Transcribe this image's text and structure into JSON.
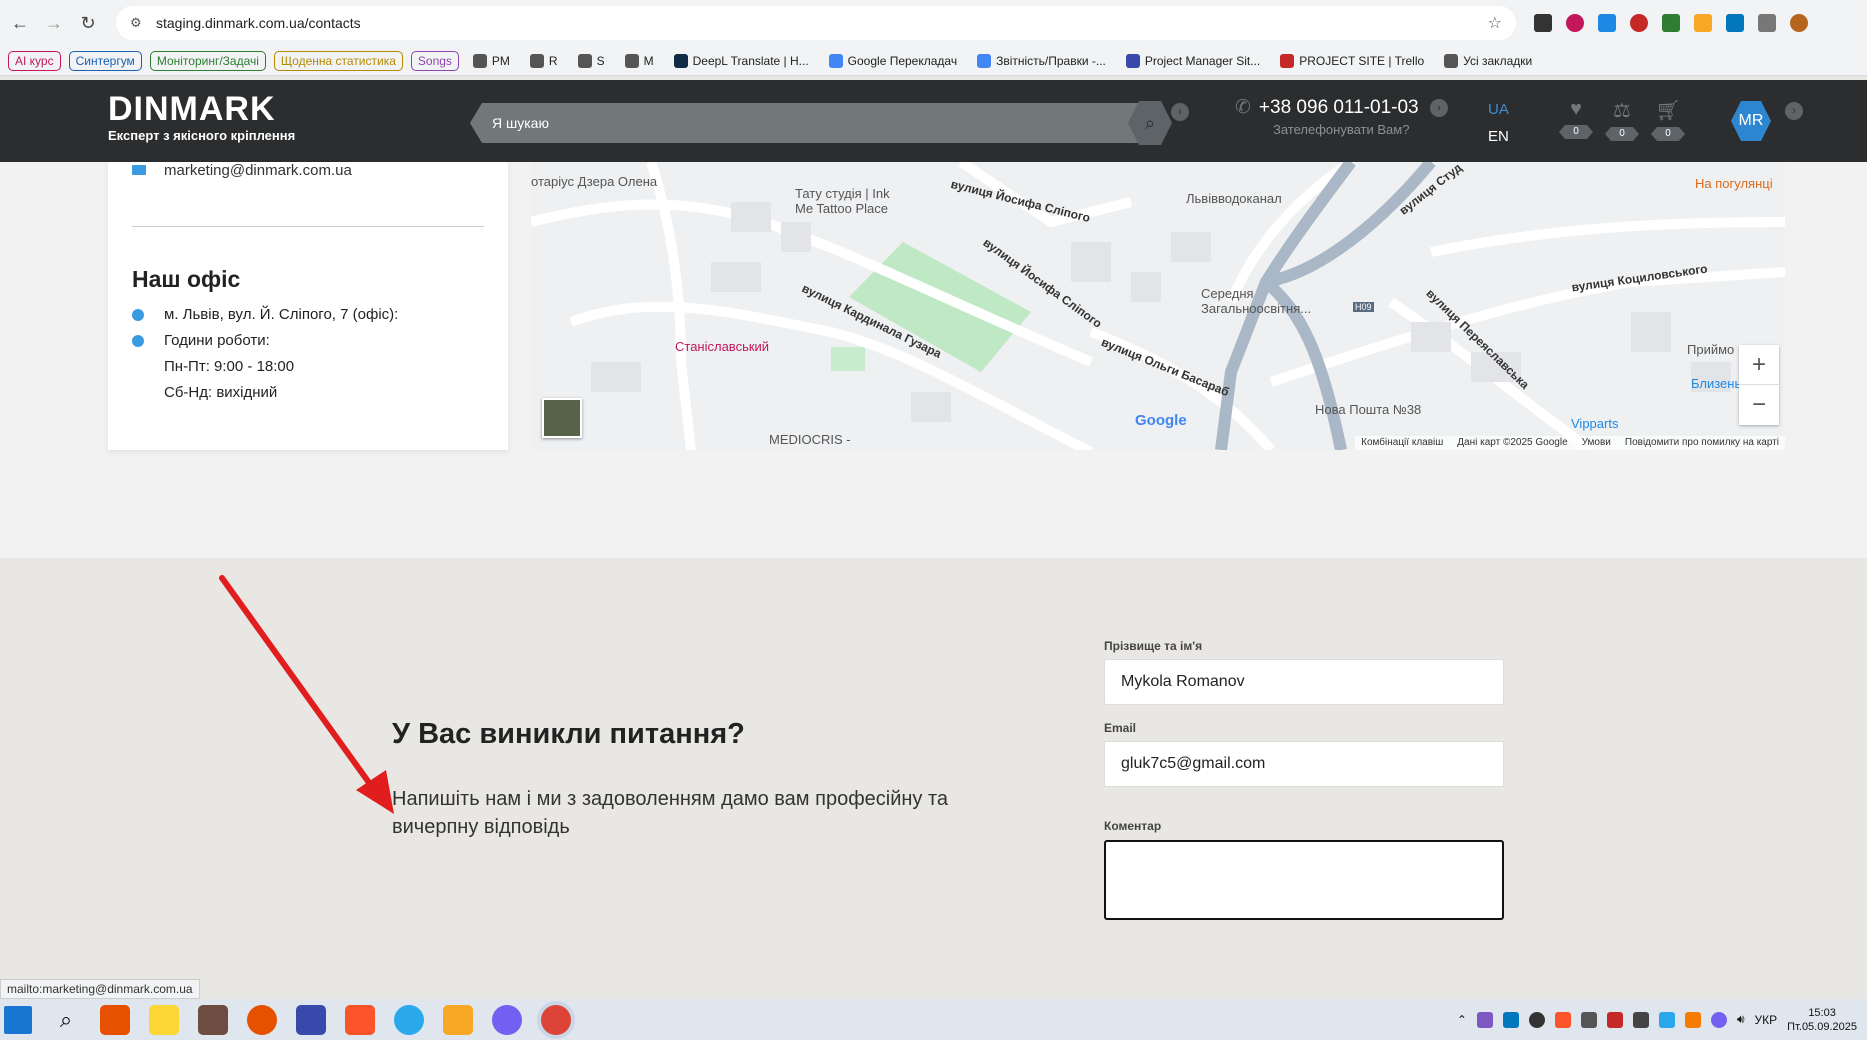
{
  "browser": {
    "url": "staging.dinmark.com.ua/contacts",
    "bookmarks": [
      {
        "label": "AI курс",
        "color": "#c2185b"
      },
      {
        "label": "Синтергум",
        "color": "#1a5fb4"
      },
      {
        "label": "Моніторинг/Задачі",
        "color": "#2e7d32"
      },
      {
        "label": "Щоденна статистика",
        "color": "#b58900"
      },
      {
        "label": "Songs",
        "color": "#8e44ad"
      },
      {
        "label": "PM",
        "color": "#555"
      },
      {
        "label": "R",
        "color": "#555"
      },
      {
        "label": "S",
        "color": "#555"
      },
      {
        "label": "M",
        "color": "#555"
      },
      {
        "label": "DeepL Translate | H...",
        "color": "#0f2b46"
      },
      {
        "label": "Google Перекладач",
        "color": "#4285f4"
      },
      {
        "label": "Звітність/Правки -...",
        "color": "#4285f4"
      },
      {
        "label": "Project Manager Sit...",
        "color": "#3949ab"
      },
      {
        "label": "PROJECT SITE | Trello",
        "color": "#c62828"
      },
      {
        "label": "Усі закладки",
        "color": "#555"
      }
    ]
  },
  "header": {
    "logo_main": "DINMARK",
    "logo_sub": "Експерт з якісного кріплення",
    "search_placeholder": "Я шукаю",
    "phone": "+38 096 011-01-03",
    "callback": "Зателефонувати Вам?",
    "lang_ua": "UA",
    "lang_en": "EN",
    "wishlist_count": "0",
    "compare_count": "0",
    "cart_count": "0",
    "avatar": "MR"
  },
  "contacts": {
    "email": "marketing@dinmark.com.ua",
    "office_title": "Наш офіс",
    "address": "м. Львів, вул. Й. Сліпого, 7 (офіс):",
    "hours_label": "Години роботи:",
    "weekdays": "Пн-Пт: 9:00 - 18:00",
    "weekend": "Сб-Нд: вихідний"
  },
  "map": {
    "labels": [
      "отаріус Дзера Олена",
      "Тату студія | Ink",
      "Me Tattoo Place",
      "вулиця Йосифа Сліпого",
      "Львівводоканал",
      "вулиця Студ",
      "На погулянці",
      "вулиця Йосифа Сліпого",
      "вулиця Коциловського",
      "вулиця Кардинала Гузара",
      "Середня",
      "Загальноосвітня...",
      "Станіславський",
      "вулиця Ольги Басараб",
      "вулиця Переяславська",
      "Приймо",
      "Близенько",
      "Нова Пошта №38",
      "Vipparts",
      "MEDIOCRIS -",
      "H09"
    ],
    "google": "Google",
    "footer": [
      "Комбінації клавіш",
      "Дані карт ©2025 Google",
      "Умови",
      "Повідомити про помилку на карті"
    ],
    "zoom_in": "+",
    "zoom_out": "−"
  },
  "form": {
    "title": "У Вас виникли питання?",
    "text": "Напишіть нам і ми з задоволенням дамо вам професійну та вичерпну відповідь",
    "name_label": "Прізвище та ім'я",
    "name_value": "Mykola Romanov",
    "email_label": "Email",
    "email_value": "gluk7c5@gmail.com",
    "comment_label": "Коментар",
    "comment_value": ""
  },
  "status_bar": "mailto:marketing@dinmark.com.ua",
  "taskbar": {
    "lang": "УКР",
    "time": "15:03",
    "date": "Пт.05.09.2025"
  }
}
